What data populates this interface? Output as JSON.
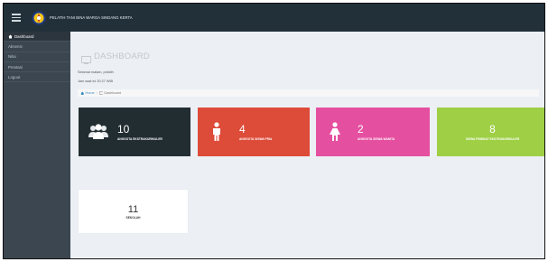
{
  "app": {
    "title": "PELATIH TANI BINA WARGA SINDANG KERTA"
  },
  "sidebar": {
    "items": [
      {
        "label": "Dashboard",
        "icon": "home-icon",
        "active": true
      },
      {
        "label": "Absensi",
        "icon": "",
        "active": false
      },
      {
        "label": "Nilai",
        "icon": "",
        "active": false
      },
      {
        "label": "Prestasi",
        "icon": "",
        "active": false
      },
      {
        "label": "Logout",
        "icon": "",
        "active": false
      }
    ]
  },
  "main": {
    "page_title": "DASHBOARD",
    "welcome": "Selamat malam, pelatih",
    "clock": "Jam saat ini 20:27 WIB",
    "breadcrumb": {
      "home": "Home",
      "current": "Dashboard"
    }
  },
  "stats": [
    {
      "value": "10",
      "label": "ANGGOTA EKSTRAKURIKULER",
      "color": "#222d32",
      "icon": "users-icon"
    },
    {
      "value": "4",
      "label": "ANGGOTA SISWA PRIA",
      "color": "#dd4b39",
      "icon": "male-icon"
    },
    {
      "value": "2",
      "label": "ANGGOTA SISWA WANITA",
      "color": "#e54fa0",
      "icon": "female-icon"
    },
    {
      "value": "8",
      "label": "SISWA PEMINAT EKSTRAKURIKULER",
      "color": "#9ecf45",
      "icon": ""
    },
    {
      "value": "11",
      "label": "SEKOLAH",
      "color": "#ffffff",
      "icon": ""
    }
  ],
  "colors": {
    "topbar": "#22303a",
    "sidebar": "#3b4650",
    "background": "#ecf0f5",
    "link": "#3c8dbc"
  }
}
